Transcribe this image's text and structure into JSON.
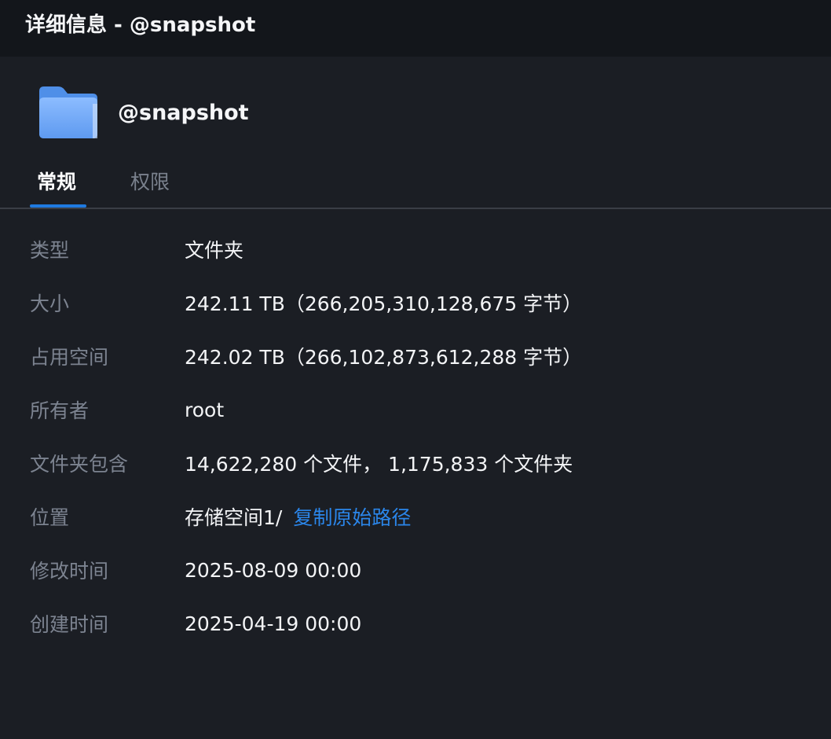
{
  "window": {
    "title": "详细信息 - @snapshot"
  },
  "header": {
    "folder_name": "@snapshot",
    "icon": "folder-icon"
  },
  "tabs": [
    {
      "label": "常规",
      "active": true
    },
    {
      "label": "权限",
      "active": false
    }
  ],
  "details": {
    "type": {
      "label": "类型",
      "value": "文件夹"
    },
    "size": {
      "label": "大小",
      "value": "242.11 TB（266,205,310,128,675 字节）"
    },
    "disk_usage": {
      "label": "占用空间",
      "value": "242.02 TB（266,102,873,612,288 字节）"
    },
    "owner": {
      "label": "所有者",
      "value": "root"
    },
    "contains": {
      "label": "文件夹包含",
      "value": "14,622,280 个文件， 1,175,833 个文件夹"
    },
    "location": {
      "label": "位置",
      "value": "存储空间1/",
      "link": "复制原始路径"
    },
    "modified": {
      "label": "修改时间",
      "value": "2025-08-09 00:00"
    },
    "created": {
      "label": "创建时间",
      "value": "2025-04-19 00:00"
    }
  },
  "colors": {
    "background": "#1b1e24",
    "titlebar": "#13161b",
    "accent": "#1f7ae0",
    "link": "#2b86ea",
    "label": "#7c8390",
    "folder": "#6ea8f7"
  }
}
